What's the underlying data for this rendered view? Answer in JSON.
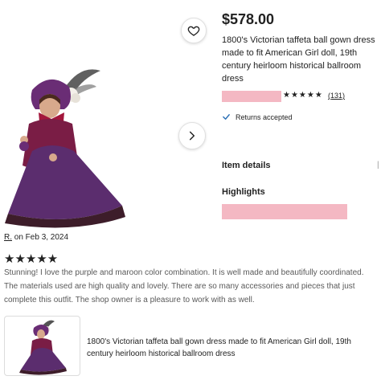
{
  "listing": {
    "price": "$578.00",
    "title": "1800's Victorian taffeta ball gown dress made to fit American Girl doll, 19th century heirloom historical ballroom dress",
    "rating_stars": "★★★★★",
    "review_count": "(131)",
    "returns": "Returns accepted",
    "item_details": "Item details",
    "highlights": "Highlights"
  },
  "icons": {
    "favorite": "heart-icon",
    "next": "chevron-right-icon",
    "check": "check-icon"
  },
  "review": {
    "reviewer": "R.",
    "date_prefix": " on Feb 3, 2024",
    "stars": "★★★★★",
    "text": "Stunning! I love the purple and maroon color combination. It is well made and beautifully coordinated. The materials used are high quality and lovely. There are so many accessories and pieces that just complete this outfit. The shop owner is a pleasure to work with as well."
  },
  "purchased_item": {
    "title": "1800's Victorian taffeta ball gown dress made to fit American Girl doll, 19th century heirloom historical ballroom dress"
  },
  "colors": {
    "redaction": "#f4b8c3",
    "gown": "#5b2d6e",
    "capelet": "#8e1c3c"
  }
}
